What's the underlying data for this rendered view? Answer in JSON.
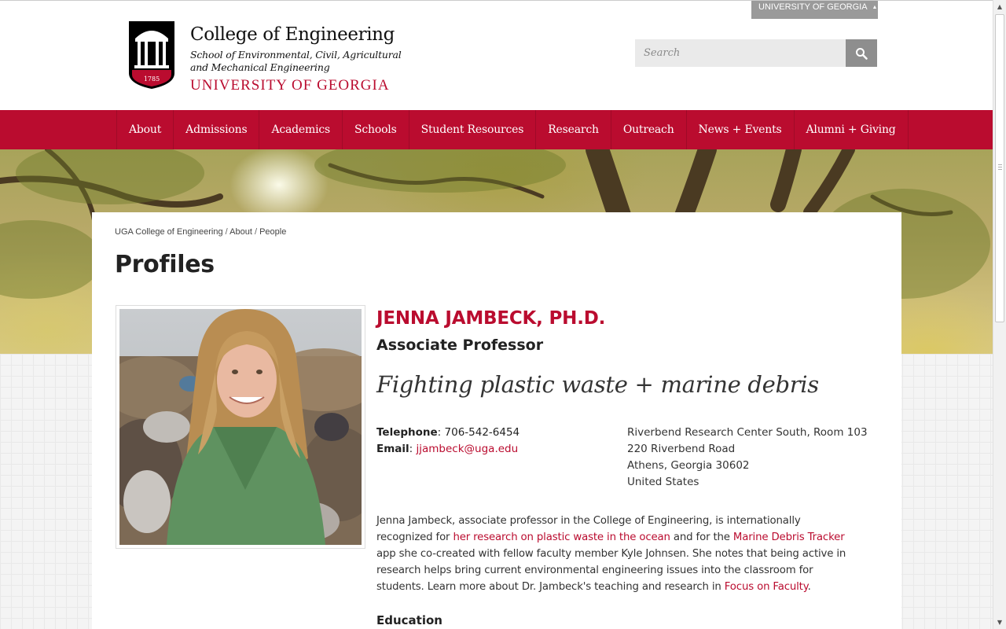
{
  "top_tab": {
    "label": "UNIVERSITY OF GEORGIA"
  },
  "brand": {
    "title": "College of Engineering",
    "school": "School of Environmental, Civil, Agricultural and Mechanical Engineering",
    "university": "UNIVERSITY OF GEORGIA",
    "logo_year": "1785"
  },
  "search": {
    "placeholder": "Search"
  },
  "nav": {
    "items": [
      {
        "label": "About"
      },
      {
        "label": "Admissions"
      },
      {
        "label": "Academics"
      },
      {
        "label": "Schools"
      },
      {
        "label": "Student Resources"
      },
      {
        "label": "Research"
      },
      {
        "label": "Outreach"
      },
      {
        "label": "News + Events"
      },
      {
        "label": "Alumni + Giving"
      }
    ]
  },
  "breadcrumb": {
    "items": [
      "UGA College of Engineering",
      "About",
      "People"
    ],
    "separator": " / "
  },
  "page": {
    "title": "Profiles"
  },
  "profile": {
    "name": "JENNA JAMBECK, PH.D.",
    "role": "Associate Professor",
    "tagline": "Fighting plastic waste + marine debris",
    "telephone_label": "Telephone",
    "telephone": "706-542-6454",
    "email_label": "Email",
    "email": "jjambeck@uga.edu",
    "address": [
      "Riverbend Research Center South, Room 103",
      "220 Riverbend Road",
      "Athens, Georgia 30602",
      "United States"
    ],
    "bio": {
      "t1": "Jenna Jambeck, associate professor in the College of Engineering, is internationally recognized for ",
      "link1": "her research on plastic waste in the ocean",
      "t2": " and for the ",
      "link2": "Marine Debris Tracker",
      "t3": " app she co-created with fellow faculty member Kyle Johnsen. She notes that being active in research helps bring current environmental engineering issues into the classroom for students. Learn more about Dr. Jambeck's teaching and research in ",
      "link3": "Focus on Faculty",
      "t4": "."
    },
    "education_heading": "Education"
  },
  "colors": {
    "accent": "#ba0c2f",
    "nav_bg": "#ba0c2f",
    "search_button": "#8e8e8e"
  },
  "icons": {
    "search": "search-icon",
    "caret": "caret-up-icon",
    "logo": "uga-arch-logo"
  }
}
